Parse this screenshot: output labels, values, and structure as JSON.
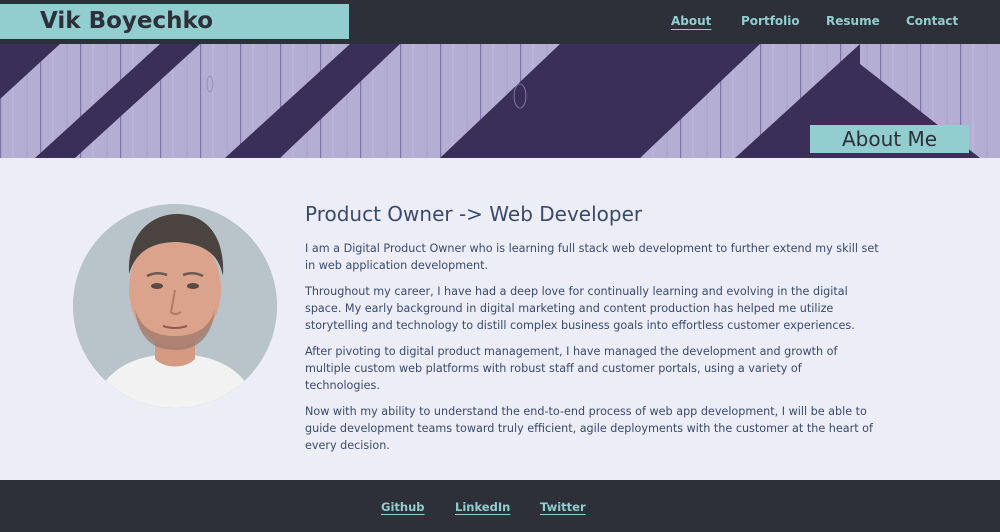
{
  "header": {
    "brand": "Vik Boyechko",
    "nav": {
      "about": "About",
      "portfolio": "Portfolio",
      "resume": "Resume",
      "contact": "Contact"
    },
    "active_item": "About"
  },
  "hero": {
    "title": "About Me"
  },
  "main": {
    "heading": "Product Owner -> Web Developer",
    "paragraphs": [
      "I am a Digital Product Owner who is learning full stack web development to further extend my skill set in web application development.",
      "Throughout my career, I have had a deep love for continually learning and evolving in the digital space. My early background in digital marketing and content production has helped me utilize storytelling and technology to distill complex business goals into effortless customer experiences.",
      "After pivoting to digital product management, I have managed the development and growth of multiple custom web platforms with robust staff and customer portals, using a variety of technologies.",
      "Now with my ability to understand the end-to-end process of web app development, I will be able to guide development teams toward truly efficient, agile deployments with the customer at the heart of every decision."
    ]
  },
  "footer": {
    "github": "Github",
    "linkedin": "LinkedIn",
    "twitter": "Twitter"
  },
  "colors": {
    "dark": "#2d3039",
    "accent": "#92ced0",
    "background": "#ecedf6",
    "text": "#3a4a6b",
    "banner_purple": "#3a2f58",
    "banner_light": "#b4aed4"
  }
}
